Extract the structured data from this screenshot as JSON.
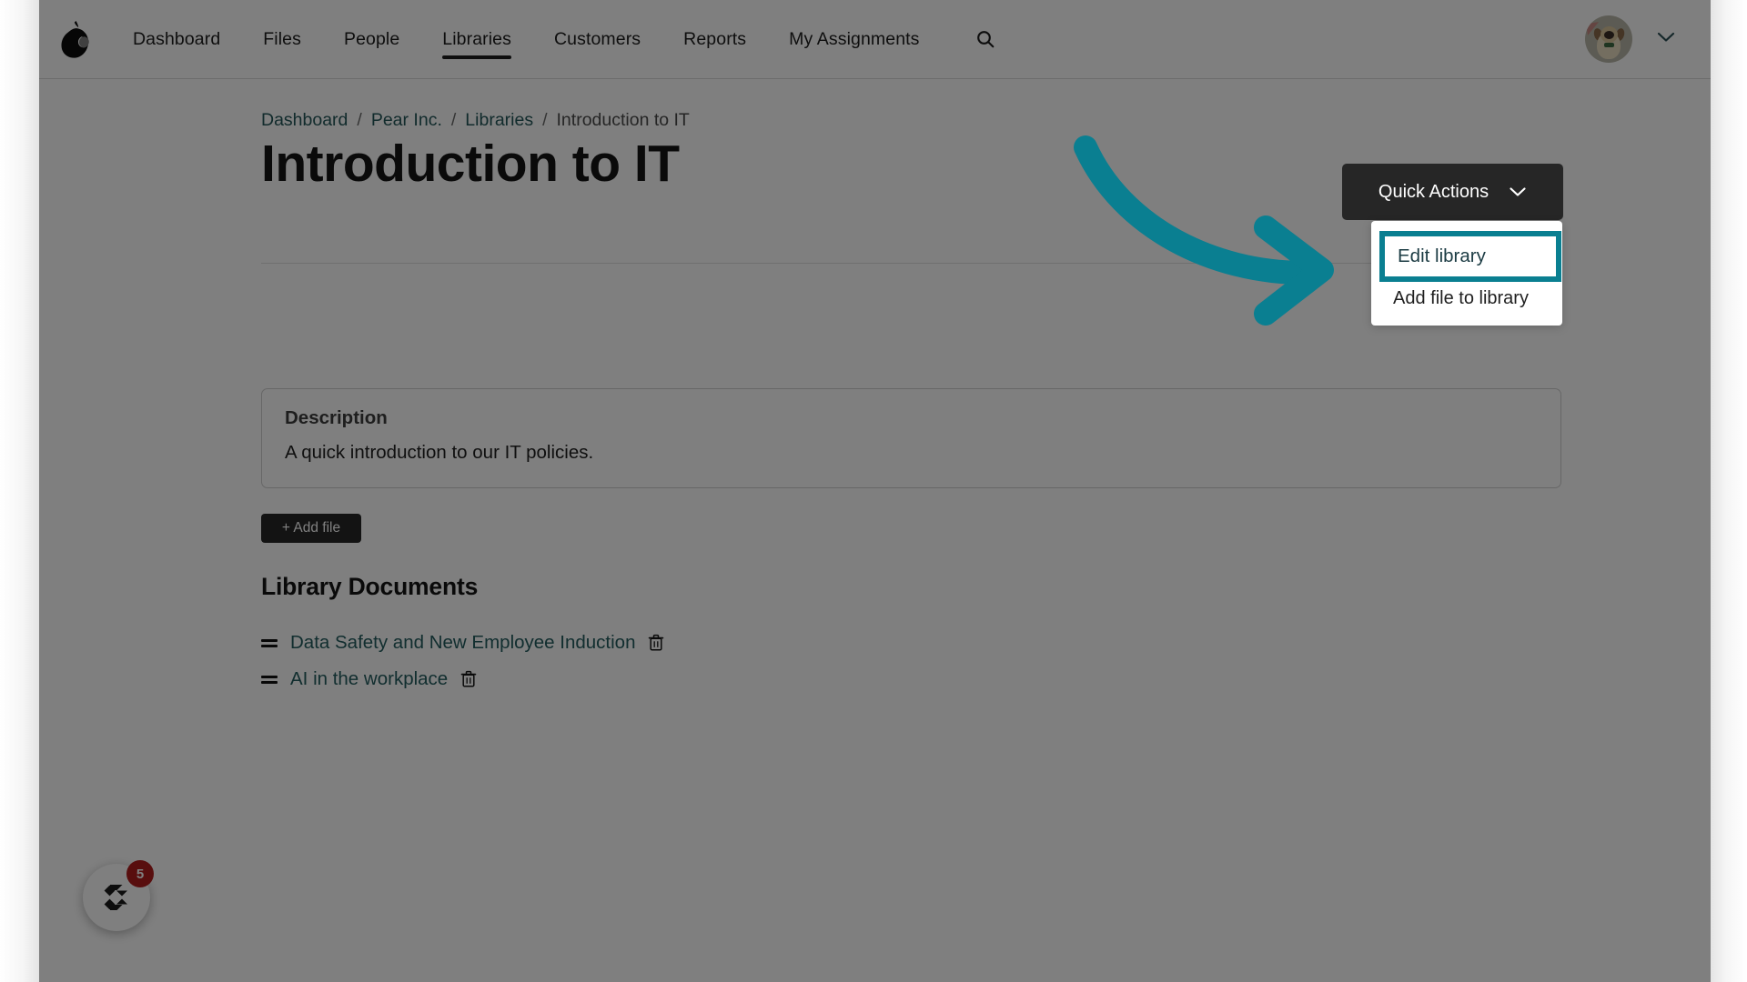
{
  "brand": {
    "logo_icon": "pear-logo-icon"
  },
  "nav": {
    "items": [
      {
        "label": "Dashboard",
        "active": false
      },
      {
        "label": "Files",
        "active": false
      },
      {
        "label": "People",
        "active": false
      },
      {
        "label": "Libraries",
        "active": true
      },
      {
        "label": "Customers",
        "active": false
      },
      {
        "label": "Reports",
        "active": false
      },
      {
        "label": "My Assignments",
        "active": false
      }
    ],
    "search_icon": "search-icon",
    "avatar_icon": "user-avatar",
    "account_chevron": "chevron-down-icon"
  },
  "breadcrumb": {
    "items": [
      {
        "label": "Dashboard",
        "link": true
      },
      {
        "label": "Pear Inc.",
        "link": true
      },
      {
        "label": "Libraries",
        "link": true
      },
      {
        "label": "Introduction to IT",
        "link": false
      }
    ],
    "separator": "/"
  },
  "page": {
    "title": "Introduction to IT"
  },
  "quick_actions": {
    "button_label": "Quick Actions",
    "chevron_icon": "chevron-down-icon",
    "menu": [
      {
        "label": "Edit library",
        "highlighted": true
      },
      {
        "label": "Add file to library",
        "highlighted": false
      }
    ]
  },
  "description": {
    "heading": "Description",
    "text": "A quick introduction to our IT policies."
  },
  "actions": {
    "add_file_label": "+ Add file"
  },
  "documents": {
    "heading": "Library Documents",
    "items": [
      {
        "name": "Data Safety and New Employee Induction",
        "drag_icon": "drag-handle-icon",
        "delete_icon": "trash-icon"
      },
      {
        "name": "AI in the workplace",
        "drag_icon": "drag-handle-icon",
        "delete_icon": "trash-icon"
      }
    ]
  },
  "chat_widget": {
    "icon": "chat-logo-icon",
    "badge_count": "5"
  },
  "annotation": {
    "arrow_icon": "curved-arrow-icon",
    "arrow_color": "#0a7f91",
    "highlight_color": "#0a7f91",
    "highlight_target": "Edit library"
  },
  "colors": {
    "accent_teal": "#0a7f91",
    "link_teal": "#235659",
    "dark_button": "#262626",
    "badge_red": "#b01c1c",
    "scrim": "rgba(0,0,0,0.50)"
  }
}
